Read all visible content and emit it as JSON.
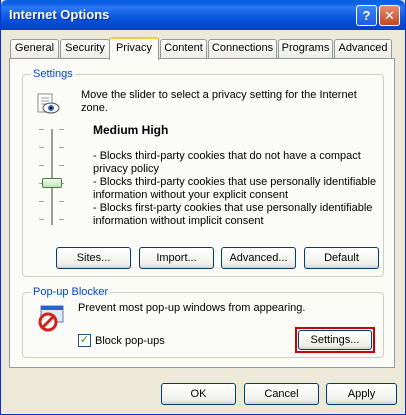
{
  "window": {
    "title": "Internet Options"
  },
  "titlebar": {
    "help_glyph": "?",
    "close_glyph": "✕"
  },
  "tabs": [
    {
      "label": "General"
    },
    {
      "label": "Security"
    },
    {
      "label": "Privacy"
    },
    {
      "label": "Content"
    },
    {
      "label": "Connections"
    },
    {
      "label": "Programs"
    },
    {
      "label": "Advanced"
    }
  ],
  "active_tab": "Privacy",
  "settings": {
    "group_label": "Settings",
    "instruction": [
      "Move the slider to select a privacy setting for the Internet",
      "zone."
    ],
    "level": "Medium High",
    "level_index": 3,
    "level_count": 6,
    "description": [
      "- Blocks third-party cookies that do not have a compact",
      "privacy policy",
      "- Blocks third-party cookies that use personally identifiable",
      "information without your explicit consent",
      "- Blocks first-party cookies that use personally identifiable",
      "information without implicit consent"
    ],
    "buttons": {
      "sites": "Sites...",
      "import": "Import...",
      "advanced": "Advanced...",
      "default": "Default"
    }
  },
  "popup_blocker": {
    "group_label": "Pop-up Blocker",
    "description": "Prevent most pop-up windows from appearing.",
    "block_popups_label": "Block pop-ups",
    "block_popups_checked": true,
    "checkmark": "✓",
    "settings_button": "Settings..."
  },
  "dialog_buttons": {
    "ok": "OK",
    "cancel": "Cancel",
    "apply": "Apply"
  },
  "colors": {
    "titlebar": "#0a5fe3",
    "group_label": "#0046d5",
    "focus_highlight": "#cc0000"
  }
}
